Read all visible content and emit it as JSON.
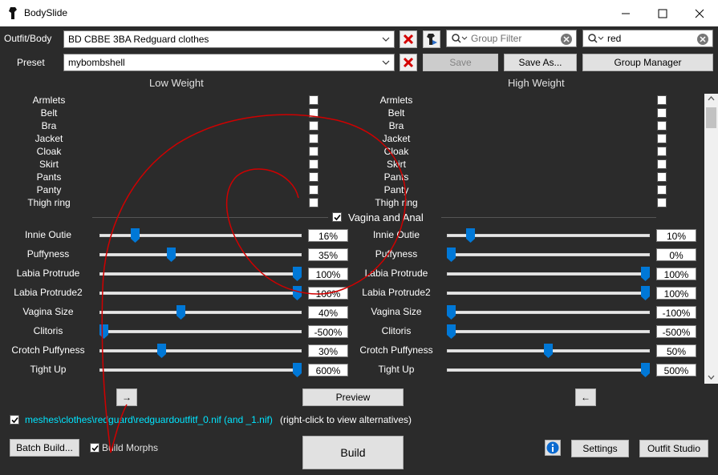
{
  "window": {
    "title": "BodySlide",
    "minimize_icon": "minimize-icon",
    "maximize_icon": "maximize-icon",
    "close_icon": "close-icon"
  },
  "outfit": {
    "label": "Outfit/Body",
    "value": "BD CBBE 3BA Redguard clothes"
  },
  "preset": {
    "label": "Preset",
    "value": "mybombshell"
  },
  "group_filter": {
    "placeholder": "Group Filter",
    "value": ""
  },
  "outfit_filter": {
    "value": "red"
  },
  "buttons": {
    "save": "Save",
    "save_as": "Save As...",
    "group_manager": "Group Manager",
    "preview": "Preview",
    "build": "Build",
    "batch_build": "Batch Build...",
    "settings": "Settings",
    "outfit_studio": "Outfit Studio",
    "arrow_right": "→",
    "arrow_left": "←"
  },
  "columns": {
    "low": "Low Weight",
    "high": "High Weight"
  },
  "zap_items": [
    "Armlets",
    "Belt",
    "Bra",
    "Jacket",
    "Cloak",
    "Skirt",
    "Pants",
    "Panty",
    "Thigh ring"
  ],
  "group": {
    "label": "Vagina and Anal",
    "checked": true
  },
  "sliders": [
    {
      "name": "Innie Outie",
      "low": 16,
      "low_text": "16%",
      "high": 10,
      "high_text": "10%"
    },
    {
      "name": "Puffyness",
      "low": 35,
      "low_text": "35%",
      "high": 0,
      "high_text": "0%"
    },
    {
      "name": "Labia Protrude",
      "low": 100,
      "low_text": "100%",
      "high": 100,
      "high_text": "100%"
    },
    {
      "name": "Labia Protrude2",
      "low": 100,
      "low_text": "100%",
      "high": 100,
      "high_text": "100%"
    },
    {
      "name": "Vagina Size",
      "low": 40,
      "low_text": "40%",
      "high": -100,
      "high_text": "-100%"
    },
    {
      "name": "Clitoris",
      "low": -500,
      "low_text": "-500%",
      "high": -500,
      "high_text": "-500%"
    },
    {
      "name": "Crotch Puffyness",
      "low": 30,
      "low_text": "30%",
      "high": 50,
      "high_text": "50%"
    },
    {
      "name": "Tight Up",
      "low": 600,
      "low_text": "600%",
      "high": 500,
      "high_text": "500%"
    }
  ],
  "output": {
    "path": "meshes\\clothes\\redguard\\redguardoutfitf_0.nif (and _1.nif)",
    "hint": "(right-click to view alternatives)",
    "path_color": "#00e5ff",
    "checked": true
  },
  "build_morphs": {
    "label": "Build Morphs",
    "checked": true
  },
  "info_icon": "info-icon",
  "colors": {
    "accent": "#0078d7",
    "danger": "#d40000",
    "annotation": "#d00000"
  }
}
